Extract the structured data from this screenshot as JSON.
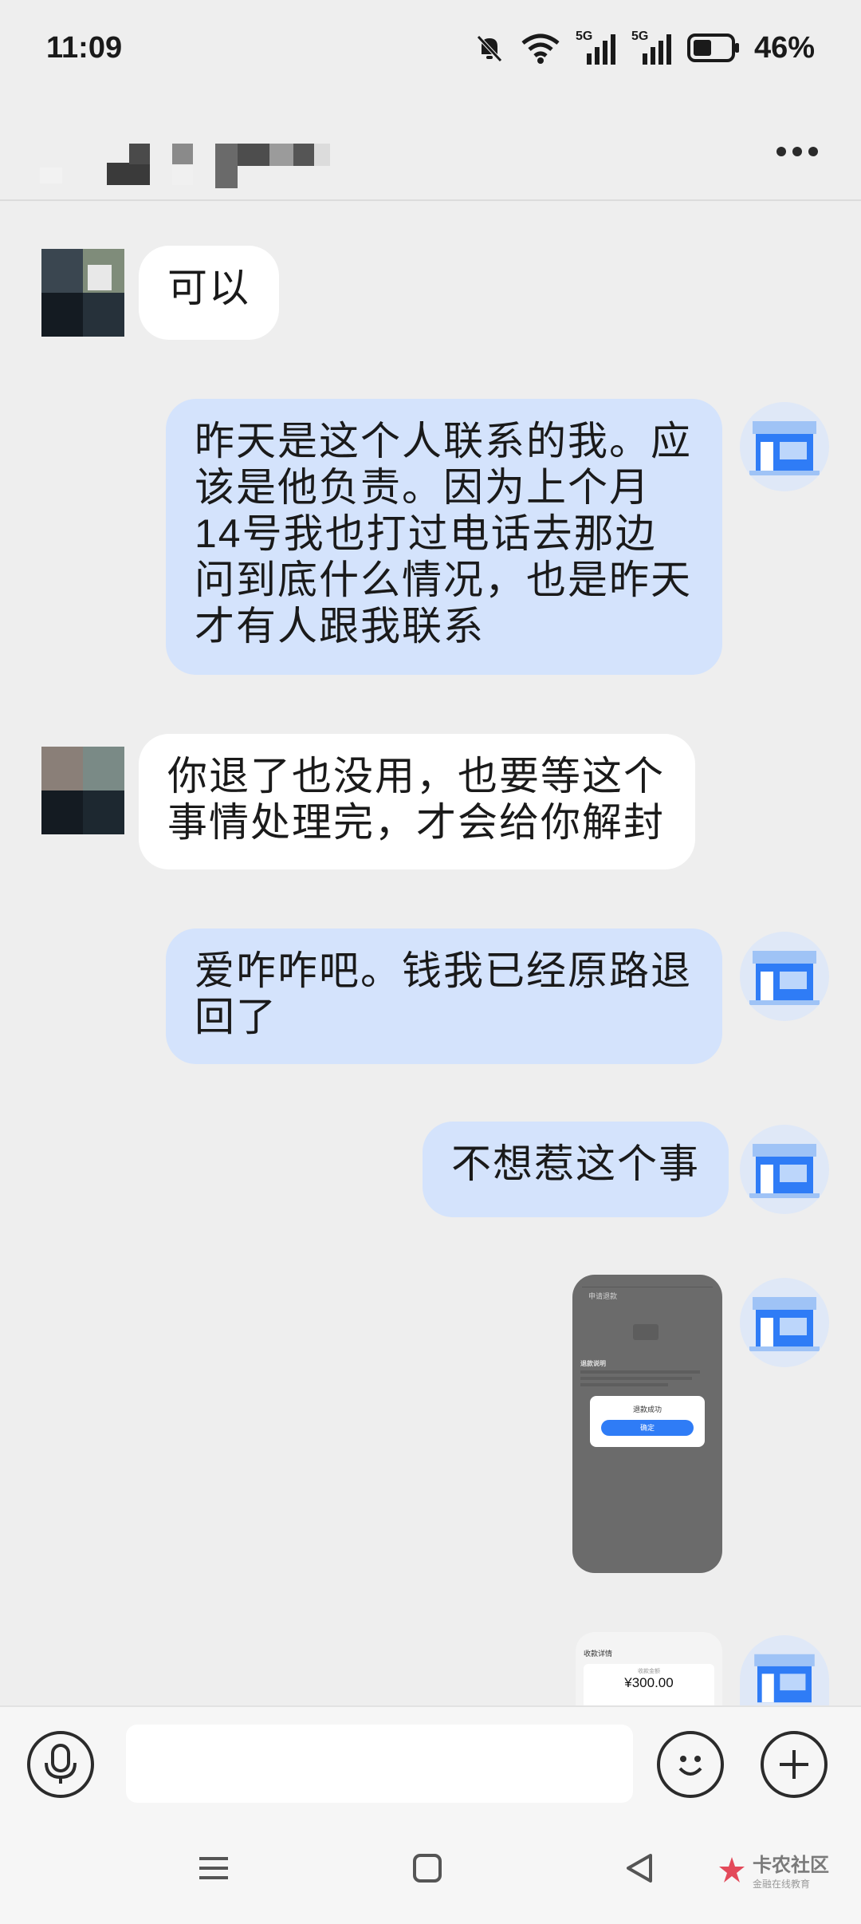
{
  "status": {
    "time": "11:09",
    "network1": "5G",
    "network2": "5G",
    "battery": "46%"
  },
  "header": {
    "title_blurred": true
  },
  "messages": [
    {
      "direction": "in",
      "text": "可以"
    },
    {
      "direction": "out",
      "text": "昨天是这个人联系的我。应该是他负责。因为上个月14号我也打过电话去那边问到底什么情况，也是昨天才有人跟我联系"
    },
    {
      "direction": "in",
      "text": "你退了也没用，也要等这个事情处理完，才会给你解封"
    },
    {
      "direction": "out",
      "text": "爱咋咋吧。钱我已经原路退回了"
    },
    {
      "direction": "out",
      "text": "不想惹这个事"
    },
    {
      "direction": "out",
      "type": "image",
      "content": {
        "title": "申请退款",
        "section": "退款说明",
        "dialog_text": "退款成功",
        "dialog_button": "确定"
      }
    },
    {
      "direction": "out",
      "type": "image",
      "content": {
        "title": "收款详情",
        "label": "收款金额",
        "amount": "¥300.00"
      }
    }
  ],
  "input": {
    "placeholder": ""
  },
  "watermark": {
    "title": "卡农社区",
    "subtitle": "金融在线教育"
  },
  "colors": {
    "bubble_out": "#d4e3fc",
    "bubble_in": "#ffffff",
    "background": "#eeeeee",
    "accent": "#2f7cf6"
  }
}
